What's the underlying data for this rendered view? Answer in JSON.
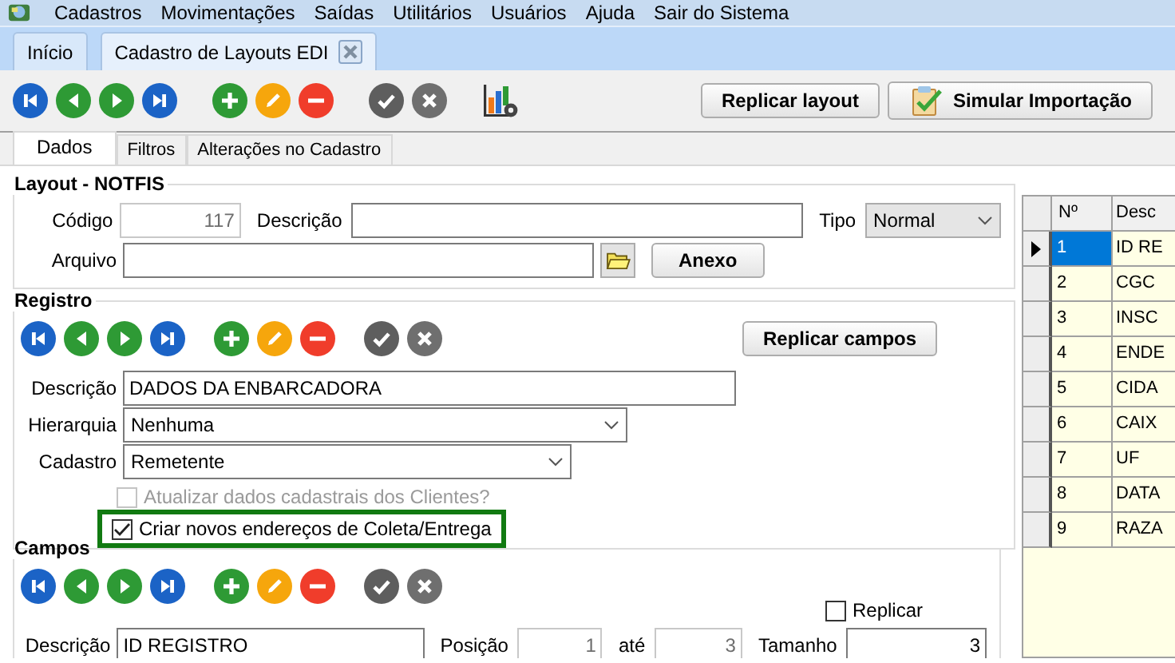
{
  "menu": [
    {
      "label": "Cadastros"
    },
    {
      "label": "Movimentações"
    },
    {
      "label": "Saídas"
    },
    {
      "label": "Utilitários"
    },
    {
      "label": "Usuários"
    },
    {
      "label": "Ajuda"
    },
    {
      "label": "Sair do Sistema"
    }
  ],
  "tabs": [
    {
      "label": "Início",
      "selected": false,
      "closable": false
    },
    {
      "label": "Cadastro de Layouts EDI",
      "selected": true,
      "closable": true
    }
  ],
  "actions": [
    {
      "label": "Replicar layout",
      "kind": "plain"
    },
    {
      "label": "Simular Importação",
      "kind": "clipboard"
    }
  ],
  "subtabs": [
    {
      "label": "Dados",
      "selected": true
    },
    {
      "label": "Filtros",
      "selected": false
    },
    {
      "label": "Alterações no Cadastro",
      "selected": false
    }
  ],
  "layout": {
    "title": "Layout - NOTFIS",
    "codigo": {
      "label": "Código",
      "value": "117",
      "readonly": true
    },
    "descricao": {
      "label": "Descrição"
    },
    "tipo": {
      "label": "Tipo",
      "value": "Normal"
    },
    "arquivo": {
      "label": "Arquivo"
    },
    "attach_button": "Anexo"
  },
  "registro": {
    "title": "Registro",
    "replicate_button": "Replicar campos",
    "descricao": {
      "label": "Descrição",
      "value": "DADOS DA ENBARCADORA"
    },
    "hierarquia": {
      "label": "Hierarquia",
      "value": "Nenhuma"
    },
    "cadastro": {
      "label": "Cadastro",
      "value": "Remetente"
    },
    "checkboxes": [
      {
        "label": "Atualizar dados cadastrais dos Clientes?",
        "checked": false,
        "disabled": true,
        "highlighted": false
      },
      {
        "label": "Criar novos endereços de Coleta/Entrega",
        "checked": true,
        "disabled": false,
        "highlighted": true
      }
    ]
  },
  "campos": {
    "title": "Campos",
    "replicar": {
      "label": "Replicar",
      "checked": false
    },
    "descricao": {
      "label": "Descrição",
      "value": "ID REGISTRO",
      "readonly": false
    },
    "posicao": {
      "label": "Posição",
      "value": "1",
      "readonly": true
    },
    "ate": {
      "label": "até",
      "value": "3",
      "readonly": true
    },
    "tamanho": {
      "label": "Tamanho",
      "value": "3",
      "readonly": false
    }
  },
  "grid": {
    "columns": [
      "Nº",
      "Desc"
    ],
    "rows": [
      {
        "number": "1",
        "description": "ID RE",
        "selected": true
      },
      {
        "number": "2",
        "description": "CGC",
        "selected": false
      },
      {
        "number": "3",
        "description": "INSC",
        "selected": false
      },
      {
        "number": "4",
        "description": "ENDE",
        "selected": false
      },
      {
        "number": "5",
        "description": "CIDA",
        "selected": false
      },
      {
        "number": "6",
        "description": "CAIX",
        "selected": false
      },
      {
        "number": "7",
        "description": "UF",
        "selected": false
      },
      {
        "number": "8",
        "description": "DATA",
        "selected": false
      },
      {
        "number": "9",
        "description": "RAZA",
        "selected": false
      }
    ]
  }
}
